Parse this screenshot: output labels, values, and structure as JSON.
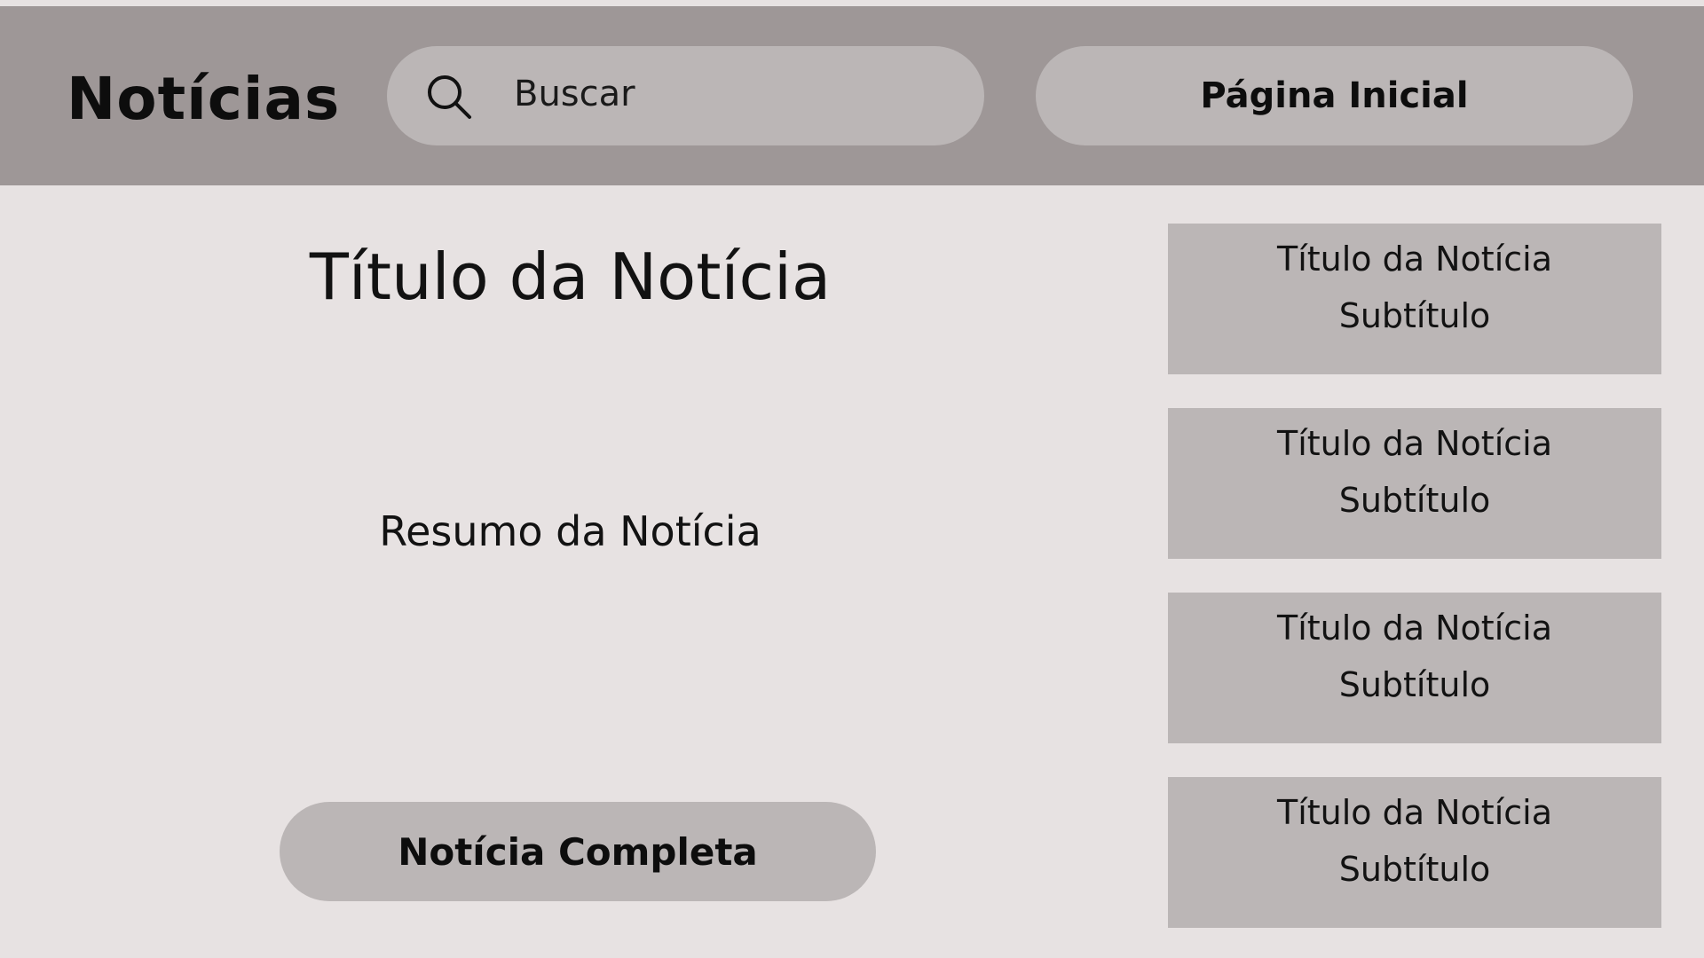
{
  "header": {
    "brand": "Notícias",
    "search": {
      "placeholder": "Buscar",
      "icon": "search-icon"
    },
    "home_label": "Página Inicial"
  },
  "main": {
    "title": "Título da Notícia",
    "summary": "Resumo da Notícia",
    "full_button_label": "Notícia Completa"
  },
  "sidebar": {
    "cards": [
      {
        "title": "Título da Notícia",
        "subtitle": "Subtítulo"
      },
      {
        "title": "Título da Notícia",
        "subtitle": "Subtítulo"
      },
      {
        "title": "Título da Notícia",
        "subtitle": "Subtítulo"
      },
      {
        "title": "Título da Notícia",
        "subtitle": "Subtítulo"
      }
    ]
  },
  "colors": {
    "header_bg": "#9e9797",
    "page_bg": "#e7e2e2",
    "control_bg": "#bbb6b6",
    "text": "#121212"
  }
}
